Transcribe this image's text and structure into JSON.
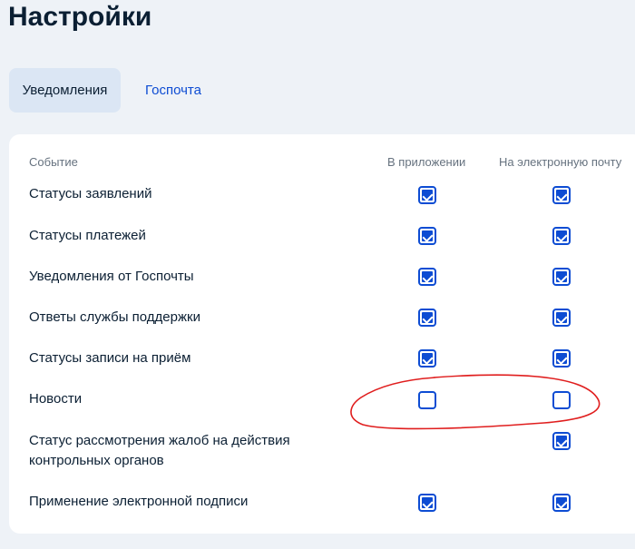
{
  "title": "Настройки",
  "tabs": [
    {
      "label": "Уведомления",
      "active": true
    },
    {
      "label": "Госпочта",
      "active": false
    }
  ],
  "table": {
    "headers": {
      "event": "Событие",
      "app": "В приложении",
      "email": "На электронную почту"
    },
    "rows": [
      {
        "label": "Статусы заявлений",
        "app": true,
        "email": true
      },
      {
        "label": "Статусы платежей",
        "app": true,
        "email": true
      },
      {
        "label": "Уведомления от Госпочты",
        "app": true,
        "email": true
      },
      {
        "label": "Ответы службы поддержки",
        "app": true,
        "email": true
      },
      {
        "label": "Статусы записи на приём",
        "app": true,
        "email": true
      },
      {
        "label": "Новости",
        "app": false,
        "email": false
      },
      {
        "label": "Статус рассмотрения жалоб на действия контрольных органов",
        "app": null,
        "email": true
      },
      {
        "label": "Применение электронной подписи",
        "app": true,
        "email": true
      }
    ]
  },
  "colors": {
    "accent": "#0d4cd3",
    "annotation": "#e01e1e"
  }
}
